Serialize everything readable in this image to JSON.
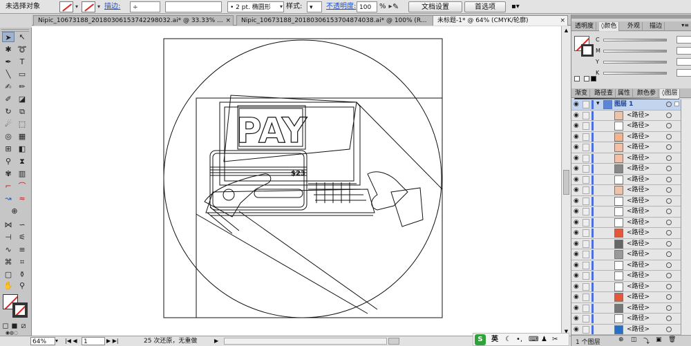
{
  "control_bar": {
    "selection_label": "未选择对象",
    "stroke_label": "描边:",
    "brush_value": "2 pt. 椭圆形",
    "style_label": "样式:",
    "opacity_label": "不透明度:",
    "opacity_value": "100",
    "opacity_unit": "%",
    "doc_setup_button": "文档设置",
    "preferences_button": "首选项"
  },
  "tabs": [
    {
      "label": "Nipic_10673188_20180306153742298032.ai* @ 33.33% ..."
    },
    {
      "label": "Nipic_10673188_20180306153704874038.ai* @ 100% (R..."
    },
    {
      "label": "未标题-1* @ 64% (CMYK/轮廓)"
    }
  ],
  "artwork": {
    "pay_text": "PAY",
    "card_code": "$23"
  },
  "status_bar": {
    "zoom": "64%",
    "artboard": "1",
    "history": "25 次还原，无重做",
    "ime_lang": "英"
  },
  "color_panel": {
    "tabs": [
      "透明度",
      "颜色",
      "外观",
      "描边"
    ],
    "channels": [
      "C",
      "M",
      "Y",
      "K"
    ]
  },
  "layers_panel": {
    "tabs": [
      "渐变",
      "路径查",
      "属性",
      "颜色参",
      "图层"
    ],
    "top_layer": "图层 1",
    "path_label": "<路径>",
    "footer_count": "1 个图层"
  },
  "colors": {
    "accent_link": "#1a4fd1",
    "path_orange": "#e2583a",
    "layer_stripe": "#4a6fe0"
  }
}
